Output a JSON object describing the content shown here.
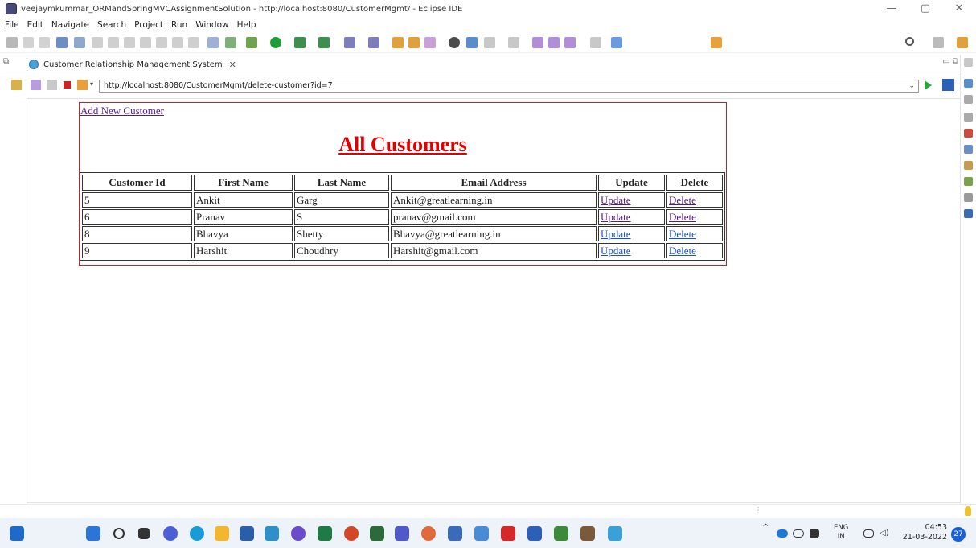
{
  "window": {
    "title": "veejaymkummar_ORMandSpringMVCAssignmentSolution - http://localhost:8080/CustomerMgmt/ - Eclipse IDE",
    "minimize": "—",
    "maximize": "▢",
    "close": "✕"
  },
  "menu": [
    "File",
    "Edit",
    "Navigate",
    "Search",
    "Project",
    "Run",
    "Window",
    "Help"
  ],
  "editor_tab": {
    "label": "Customer Relationship Management System",
    "close": "✕"
  },
  "browser": {
    "url": "http://localhost:8080/CustomerMgmt/delete-customer?id=7"
  },
  "page": {
    "add_link": "Add New Customer",
    "heading": "All Customers",
    "columns": [
      "Customer Id",
      "First Name",
      "Last Name",
      "Email Address",
      "Update",
      "Delete"
    ],
    "rows": [
      {
        "id": "5",
        "first": "Ankit",
        "last": "Garg",
        "email": "Ankit@greatlearning.in",
        "update": "Update",
        "delete": "Delete"
      },
      {
        "id": "6",
        "first": "Pranav",
        "last": "S",
        "email": "pranav@gmail.com",
        "update": "Update",
        "delete": "Delete"
      },
      {
        "id": "8",
        "first": "Bhavya",
        "last": "Shetty",
        "email": "Bhavya@greatlearning.in",
        "update": "Update",
        "delete": "Delete"
      },
      {
        "id": "9",
        "first": "Harshit",
        "last": "Choudhry",
        "email": "Harshit@gmail.com",
        "update": "Update",
        "delete": "Delete"
      }
    ]
  },
  "taskbar": {
    "language": "ENG",
    "region": "IN",
    "time": "04:53",
    "date": "21-03-2022",
    "notifications": "27"
  },
  "colors": {
    "heading": "#e00000",
    "page_border": "#cc1f1f",
    "visited_link": "#551a8b",
    "link": "#1a4fd6"
  }
}
